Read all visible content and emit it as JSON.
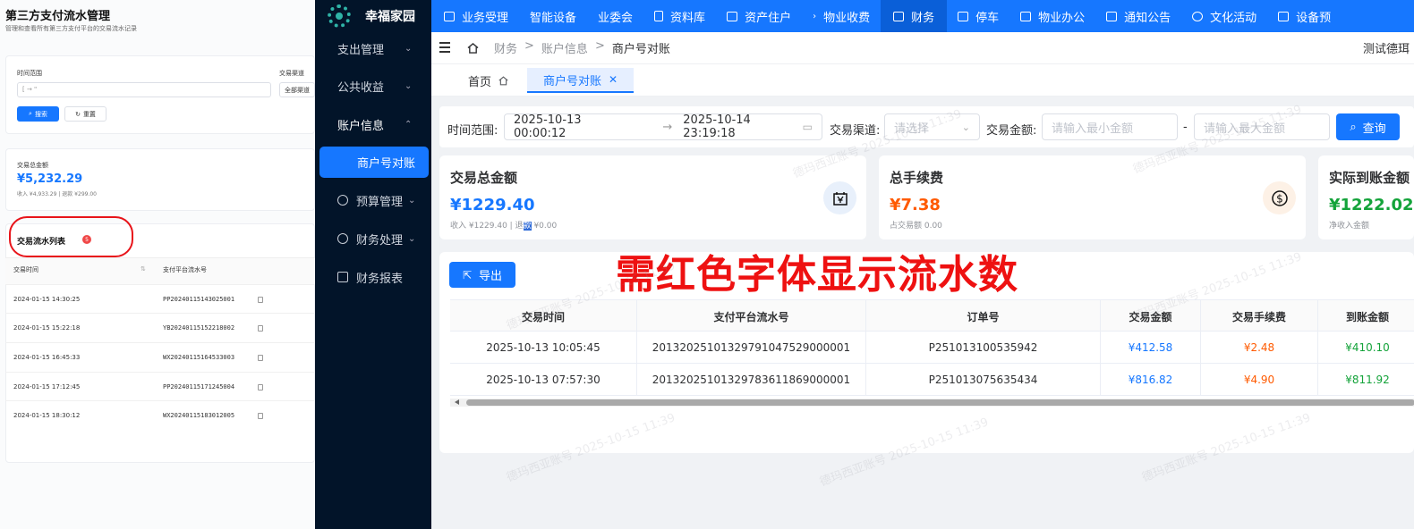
{
  "left_panel": {
    "title": "第三方支付流水管理",
    "subtitle": "管理和查看所有第三方支付平台的交易流水记录",
    "time_range_label": "时间范围",
    "time_input_value": "[                                      →  \"",
    "channel_label": "交易渠道",
    "channel_value": "全部渠道",
    "search_button": "搜索",
    "reset_button": "重置",
    "total_label": "交易总金额",
    "total_value": "¥5,232.29",
    "total_sub": "收入 ¥4,933.29 | 退款 ¥299.00",
    "list_title": "交易流水列表",
    "list_badge": "5",
    "col_time": "交易时间",
    "col_serial": "支付平台流水号",
    "rows": [
      {
        "time": "2024-01-15 14:30:25",
        "serial": "PP20240115143025001"
      },
      {
        "time": "2024-01-15 15:22:18",
        "serial": "YB20240115152218002"
      },
      {
        "time": "2024-01-15 16:45:33",
        "serial": "WX20240115164533003"
      },
      {
        "time": "2024-01-15 17:12:45",
        "serial": "PP20240115171245004"
      },
      {
        "time": "2024-01-15 18:30:12",
        "serial": "WX20240115183012005"
      }
    ]
  },
  "app": {
    "name": "幸福家园",
    "top_nav": [
      "业务受理",
      "智能设备",
      "业委会",
      "资料库",
      "资产住户",
      "物业收费",
      "财务",
      "停车",
      "物业办公",
      "通知公告",
      "文化活动",
      "设备预"
    ],
    "active_nav": "财务",
    "user": "测试德珥"
  },
  "sidebar": {
    "items": [
      {
        "label": "支出管理"
      },
      {
        "label": "公共收益"
      },
      {
        "label": "账户信息"
      },
      {
        "label": "商户号对账"
      },
      {
        "label": "预算管理"
      },
      {
        "label": "财务处理"
      },
      {
        "label": "财务报表"
      }
    ]
  },
  "breadcrumb": [
    "财务",
    ">",
    "账户信息",
    ">",
    "商户号对账"
  ],
  "tabs": {
    "home": "首页",
    "active": "商户号对账"
  },
  "filter": {
    "time_label": "时间范围:",
    "start": "2025-10-13 00:00:12",
    "end": "2025-10-14 23:19:18",
    "channel_label": "交易渠道:",
    "channel_placeholder": "请选择",
    "amount_label": "交易金额:",
    "min_placeholder": "请输入最小金额",
    "dash": "-",
    "max_placeholder": "请输入最大金额",
    "query_button": "查询"
  },
  "stats": [
    {
      "title": "交易总金额",
      "value": "¥1229.40",
      "sub_a": "收入 ¥1229.40 | 退",
      "sub_hl": "款",
      "sub_b": " ¥0.00",
      "color": "#1677ff"
    },
    {
      "title": "总手续费",
      "value": "¥7.38",
      "sub": "占交易额 0.00",
      "color": "#ff5a00"
    },
    {
      "title": "实际到账金额",
      "value": "¥1222.02",
      "sub": "净收入金额",
      "color": "#14a33a"
    }
  ],
  "export_button": "导出",
  "annotation": "需红色字体显示流水数",
  "table": {
    "columns": [
      "交易时间",
      "支付平台流水号",
      "订单号",
      "交易金额",
      "交易手续费",
      "到账金额"
    ],
    "rows": [
      {
        "time": "2025-10-13 10:05:45",
        "serial": "20132025101329791047529000001",
        "order": "P251013100535942",
        "amount": "¥412.58",
        "fee": "¥2.48",
        "net": "¥410.10"
      },
      {
        "time": "2025-10-13 07:57:30",
        "serial": "20132025101329783611869000001",
        "order": "P251013075635434",
        "amount": "¥816.82",
        "fee": "¥4.90",
        "net": "¥811.92"
      }
    ]
  },
  "watermark": "德玛西亚账号 2025-10-15 11:39",
  "colors": {
    "primary": "#1677ff",
    "sidebar": "#021429",
    "annotation": "#ee1111",
    "fee": "#ff5a00",
    "net": "#14a33a"
  }
}
